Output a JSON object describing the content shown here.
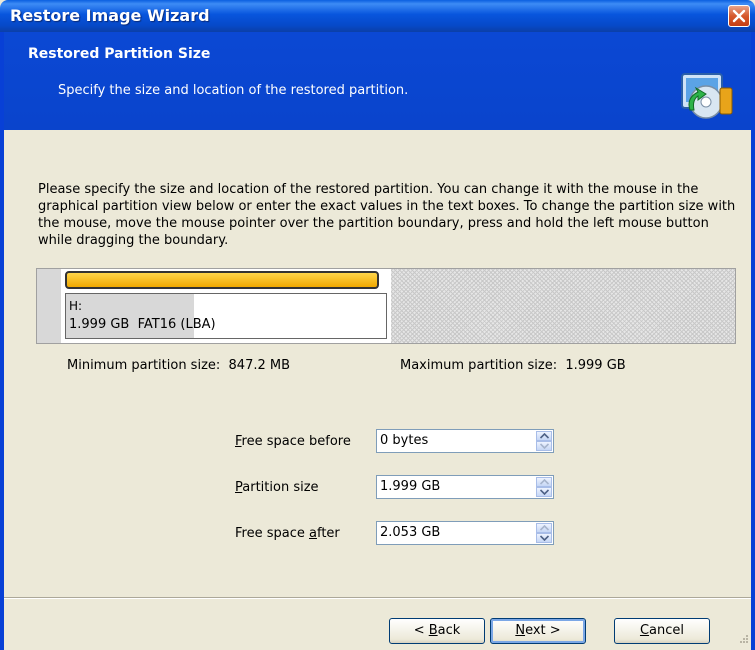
{
  "window": {
    "title": "Restore Image Wizard"
  },
  "header": {
    "title": "Restored Partition Size",
    "subtitle": "Specify the size and location of the restored partition.",
    "icon": "wizard-restore-icon"
  },
  "description": "Please specify the size and location of the restored partition. You can change it with the mouse in the graphical partition view below or enter the exact values in the text boxes. To change the partition size with the mouse, move the mouse pointer over the partition boundary, press and hold the left mouse button while dragging the boundary.",
  "partition_view": {
    "drive_letter": "H:",
    "details": "1.999 GB  FAT16 (LBA)"
  },
  "limits": {
    "min": "Minimum partition size:  847.2 MB",
    "max": "Maximum partition size:  1.999 GB"
  },
  "fields": {
    "free_before": {
      "label_mnemonic": "F",
      "label_rest": "ree space before",
      "value": "0 bytes"
    },
    "partition_size": {
      "label_mnemonic": "P",
      "label_rest": "artition size",
      "value": "1.999 GB"
    },
    "free_after": {
      "label_pre": "Free space ",
      "label_mnemonic": "a",
      "label_rest": "fter",
      "value": "2.053 GB"
    }
  },
  "buttons": {
    "back_pre": "< ",
    "back_mn": "B",
    "back_rest": "ack",
    "next_mn": "N",
    "next_rest": "ext >",
    "cancel_mn": "C",
    "cancel_rest": "ancel"
  },
  "colors": {
    "title_bar": "#0a5fe0",
    "header_band": "#0a46d2",
    "partition_bar": "#f0a800",
    "dialog_bg": "#ece9d8"
  }
}
